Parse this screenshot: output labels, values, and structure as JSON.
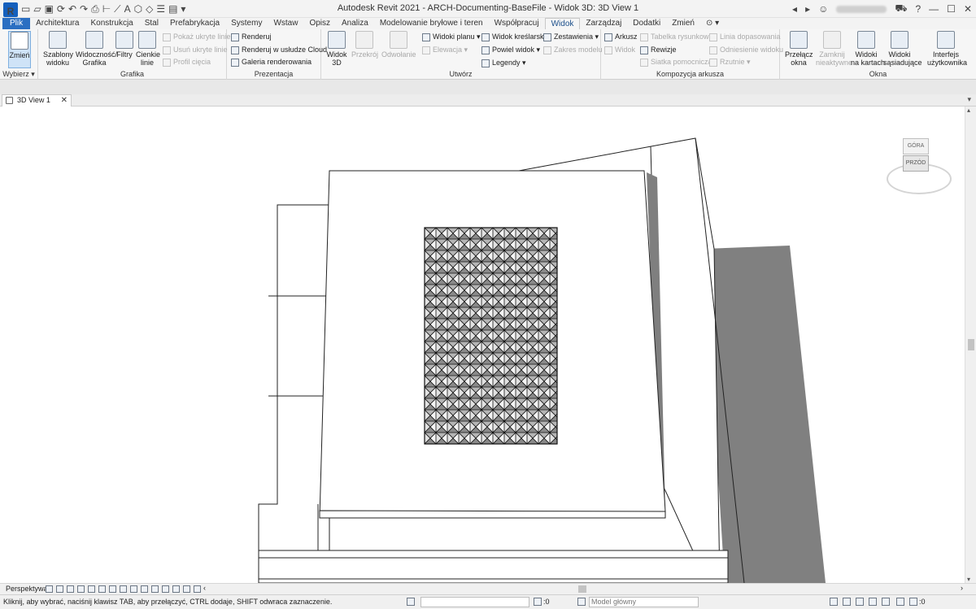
{
  "app": {
    "window_title": "Autodesk Revit 2021 - ARCH-Documenting-BaseFile - Widok 3D: 3D View 1",
    "logo_letter": "R"
  },
  "titlebar_controls": {
    "minimize": "—",
    "maximize": "☐",
    "close": "✕",
    "help": "?",
    "nav_back": "◂",
    "nav_fwd": "▸"
  },
  "tabs": [
    {
      "label": "Plik"
    },
    {
      "label": "Architektura"
    },
    {
      "label": "Konstrukcja"
    },
    {
      "label": "Stal"
    },
    {
      "label": "Prefabrykacja"
    },
    {
      "label": "Systemy"
    },
    {
      "label": "Wstaw"
    },
    {
      "label": "Opisz"
    },
    {
      "label": "Analiza"
    },
    {
      "label": "Modelowanie bryłowe i teren"
    },
    {
      "label": "Współpracuj"
    },
    {
      "label": "Widok"
    },
    {
      "label": "Zarządzaj"
    },
    {
      "label": "Dodatki"
    },
    {
      "label": "Zmień"
    }
  ],
  "ribbon": {
    "select_panel": {
      "button": "Zmień",
      "label": "Wybierz"
    },
    "graphics_panel": {
      "label": "Grafika",
      "templates": "Szablony\nwidoku",
      "visibility": "Widoczność/\nGrafika",
      "filters": "Filtry",
      "thin_lines": "Cienkie\nlinie",
      "show_hidden": "Pokaż ukryte linie",
      "remove_hidden": "Usuń ukryte linie",
      "cut_profile": "Profil cięcia"
    },
    "presentation_panel": {
      "label": "Prezentacja",
      "render": "Renderuj",
      "render_cloud": "Renderuj w  usłudze Cloud",
      "render_gallery": "Galeria  renderowania"
    },
    "create_panel": {
      "label": "Utwórz",
      "view3d": "Widok\n3D",
      "section": "Przekrój",
      "callout": "Odwołanie",
      "plan_views": "Widoki planu",
      "elevation": "Elewacja",
      "drafting_view": "Widok kreślarski",
      "duplicate_view": "Powiel widok",
      "legends": "Legendy",
      "schedules": "Zestawienia",
      "scope_box": "Zakres modelu"
    },
    "sheet_panel": {
      "label": "Kompozycja arkusza",
      "sheet": "Arkusz",
      "view": "Widok",
      "title_block": "Tabelka rysunkowa",
      "revisions": "Rewizje",
      "guide_grid": "Siatka pomocnicza",
      "matchline": "Linia dopasowania",
      "view_reference": "Odniesienie widoku",
      "viewports": "Rzutnie"
    },
    "windows_panel": {
      "label": "Okna",
      "switch": "Przełącz\nokna",
      "close_inactive": "Zamknij\nnieaktywne",
      "tab_views": "Widoki\nna kartach",
      "tile_views": "Widoki\nsąsiadujące",
      "ui": "Interfejs\nużytkownika"
    }
  },
  "view_tab": {
    "label": "3D View 1",
    "close": "✕"
  },
  "viewcube": {
    "top": "GÓRA",
    "front": "PRZÓD"
  },
  "viewbar": {
    "mode": "Perspektywa",
    "arrow_left": "‹",
    "arrow_right": "›"
  },
  "status": {
    "message": "Kliknij, aby wybrać, naciśnij klawisz TAB, aby przełączyć, CTRL dodaje, SHIFT odwraca zaznaczenie.",
    "selection_count": ":0",
    "model_select": "Model główny",
    "filter_count": ":0"
  },
  "colors": {
    "file_tab": "#2b6fc2",
    "ribbon_bg": "#f6f6f6",
    "shade_gray": "#808080"
  }
}
